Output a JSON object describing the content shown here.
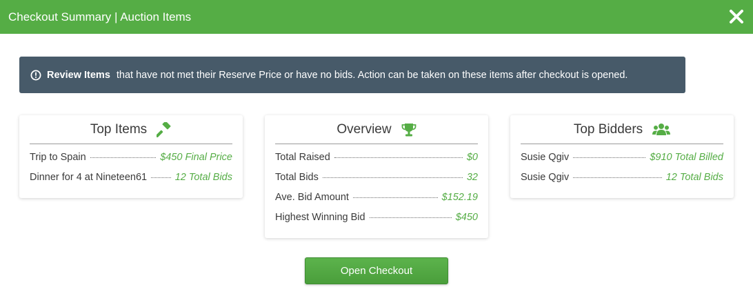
{
  "header": {
    "title": "Checkout Summary | Auction Items",
    "close_icon": "close-x-icon"
  },
  "alert": {
    "icon": "exclamation-circle-icon",
    "strong": "Review Items",
    "text": "that have not met their Reserve Price or have no bids. Action can be taken on these items after checkout is opened."
  },
  "top_items": {
    "title": "Top Items",
    "icon": "gavel-icon",
    "rows": [
      {
        "label": "Trip to Spain",
        "value": "$450 Final Price"
      },
      {
        "label": "Dinner for 4 at Nineteen61",
        "value": "12 Total Bids"
      }
    ]
  },
  "overview": {
    "title": "Overview",
    "icon": "trophy-icon",
    "rows": [
      {
        "label": "Total Raised",
        "value": "$0"
      },
      {
        "label": "Total Bids",
        "value": "32"
      },
      {
        "label": "Ave. Bid Amount",
        "value": "$152.19"
      },
      {
        "label": "Highest Winning Bid",
        "value": "$450"
      }
    ]
  },
  "top_bidders": {
    "title": "Top Bidders",
    "icon": "users-icon",
    "rows": [
      {
        "label": "Susie Qgiv",
        "value": "$910 Total Billed"
      },
      {
        "label": "Susie Qgiv",
        "value": "12 Total Bids"
      }
    ]
  },
  "open_checkout_label": "Open Checkout",
  "colors": {
    "brand_green": "#55ad45",
    "alert_bg": "#475a69"
  }
}
